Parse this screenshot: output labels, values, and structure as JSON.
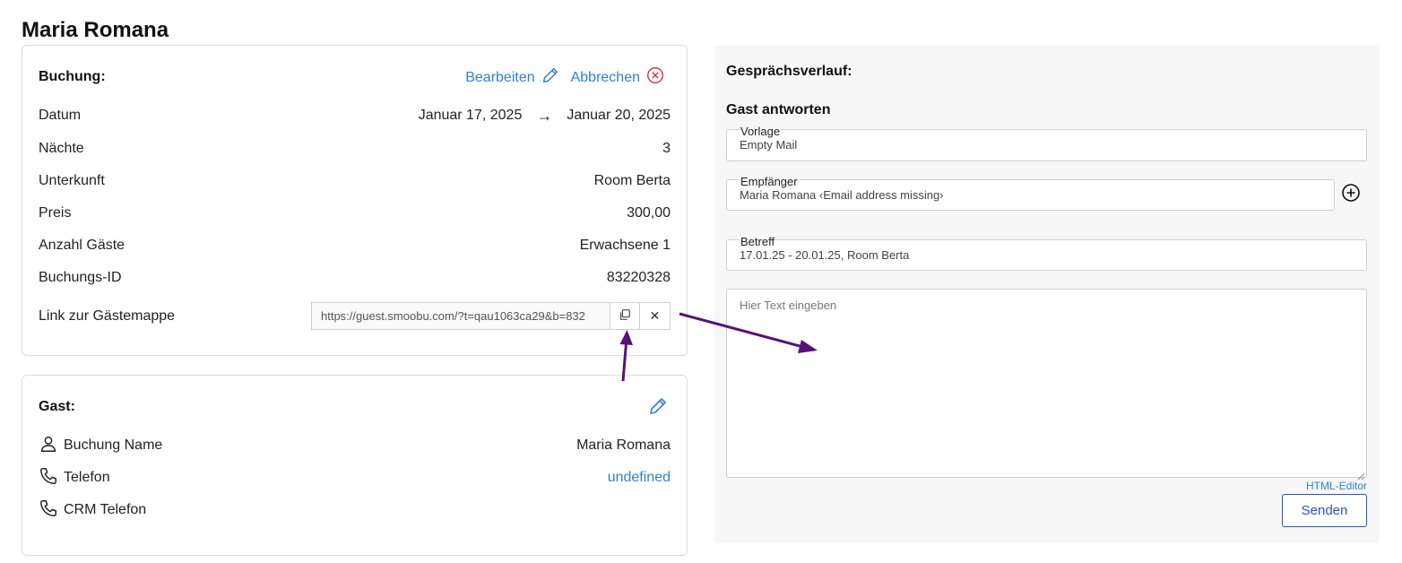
{
  "page": {
    "title": "Maria Romana"
  },
  "booking": {
    "heading": "Buchung:",
    "edit_label": "Bearbeiten",
    "cancel_label": "Abbrechen",
    "rows": {
      "date_label": "Datum",
      "date_from": "Januar 17, 2025",
      "date_arrow": "→",
      "date_to": "Januar 20, 2025",
      "nights_label": "Nächte",
      "nights_value": "3",
      "accommodation_label": "Unterkunft",
      "accommodation_value": "Room Berta",
      "price_label": "Preis",
      "price_value": "300,00",
      "guests_label": "Anzahl Gäste",
      "guests_value": "Erwachsene 1",
      "booking_id_label": "Buchungs-ID",
      "booking_id_value": "83220328",
      "guestbook_label": "Link zur Gästemappe",
      "guestbook_link": "https://guest.smoobu.com/?t=qau1063ca29&b=832"
    },
    "copy_icon": "copy-icon",
    "clear_glyph": "✕"
  },
  "guest": {
    "heading": "Gast:",
    "name_label": "Buchung Name",
    "name_value": "Maria Romana",
    "phone_label": "Telefon",
    "phone_value": "undefined",
    "crm_phone_label": "CRM Telefon"
  },
  "conversation": {
    "heading": "Gesprächsverlauf:",
    "reply_heading": "Gast antworten",
    "template_label": "Vorlage",
    "template_value": "Empty Mail",
    "recipient_label": "Empfänger",
    "recipient_value": "Maria Romana ‹Email address missing›",
    "subject_label": "Betreff",
    "subject_value": "17.01.25 - 20.01.25, Room Berta",
    "message_placeholder": "Hier Text eingeben",
    "html_editor_label": "HTML-Editor",
    "send_label": "Senden"
  },
  "colors": {
    "link_blue": "#2f7fd6",
    "send_blue": "#2b4fd6",
    "annotation_purple": "#5b0f7a",
    "cancel_red": "#e0334c"
  }
}
